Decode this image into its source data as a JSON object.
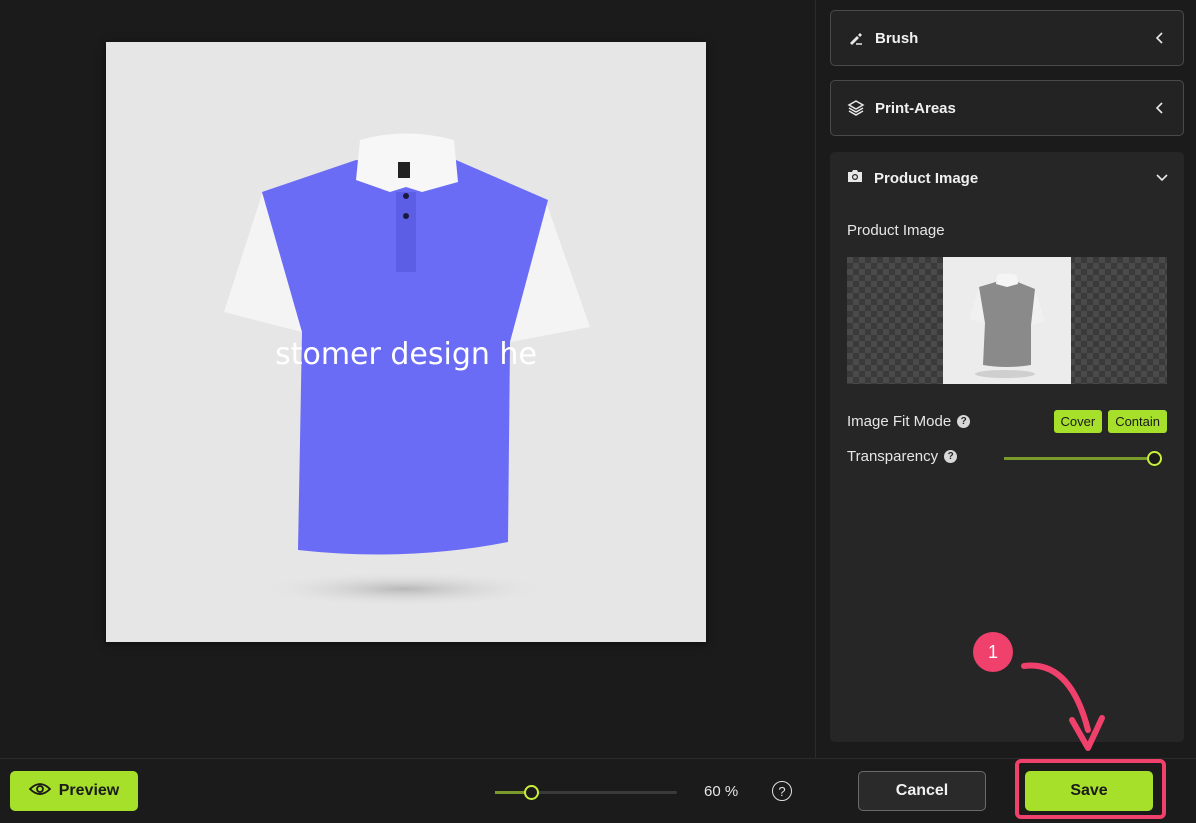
{
  "panels": {
    "brush": {
      "title": "Brush",
      "icon": "brush-icon"
    },
    "print_areas": {
      "title": "Print-Areas",
      "icon": "layers-icon"
    },
    "product_image": {
      "title": "Product Image",
      "icon": "camera-icon",
      "label": "Product Image",
      "fit_mode_label": "Image Fit Mode",
      "fit_options": [
        "Cover",
        "Contain"
      ],
      "transparency_label": "Transparency",
      "transparency_value": 1.0
    }
  },
  "canvas": {
    "design_text": "stomer design he"
  },
  "bottom_bar": {
    "preview_label": "Preview",
    "zoom_level": "60 %",
    "zoom_slider_value": 0.2,
    "help_glyph": "?",
    "cancel_label": "Cancel",
    "save_label": "Save"
  },
  "annotation": {
    "step_number": "1"
  },
  "colors": {
    "accent": "#a6e02a",
    "highlight": "#f0416c",
    "shirt_body": "#6b6cf5"
  }
}
